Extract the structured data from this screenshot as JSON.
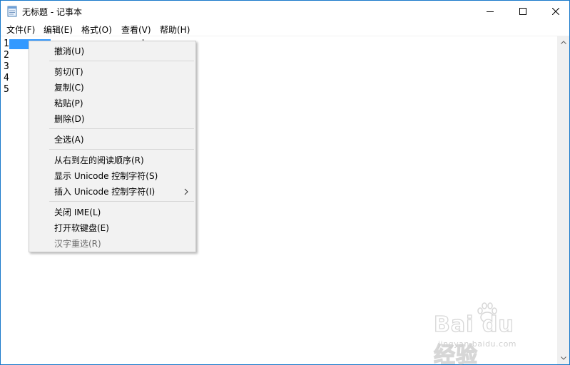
{
  "window": {
    "title": "无标题 - 记事本"
  },
  "menubar": [
    {
      "label": "文件(F)"
    },
    {
      "label": "编辑(E)"
    },
    {
      "label": "格式(O)"
    },
    {
      "label": "查看(V)"
    },
    {
      "label": "帮助(H)"
    }
  ],
  "editor": {
    "lines": [
      "1",
      "2",
      "3",
      "4",
      "5"
    ]
  },
  "context_menu": {
    "undo": "撤消(U)",
    "cut": "剪切(T)",
    "copy": "复制(C)",
    "paste": "粘贴(P)",
    "delete": "删除(D)",
    "select_all": "全选(A)",
    "rtl_reading": "从右到左的阅读顺序(R)",
    "show_unicode": "显示 Unicode 控制字符(S)",
    "insert_unicode": "插入 Unicode 控制字符(I)",
    "close_ime": "关闭 IME(L)",
    "soft_keyboard": "打开软键盘(E)",
    "reconversion": "汉字重选(R)"
  },
  "watermark": {
    "brand": "Bai du 经验",
    "url": "jingyan.baidu.com"
  },
  "colors": {
    "window_border": "#1979ca",
    "selection": "#3399ff",
    "menu_bg": "#f2f2f2",
    "disabled_text": "#6d6d6d"
  },
  "icons": {
    "app": "notepad-icon",
    "minimize": "minimize-icon",
    "maximize": "maximize-icon",
    "close": "close-icon",
    "submenu": "chevron-right-icon"
  }
}
